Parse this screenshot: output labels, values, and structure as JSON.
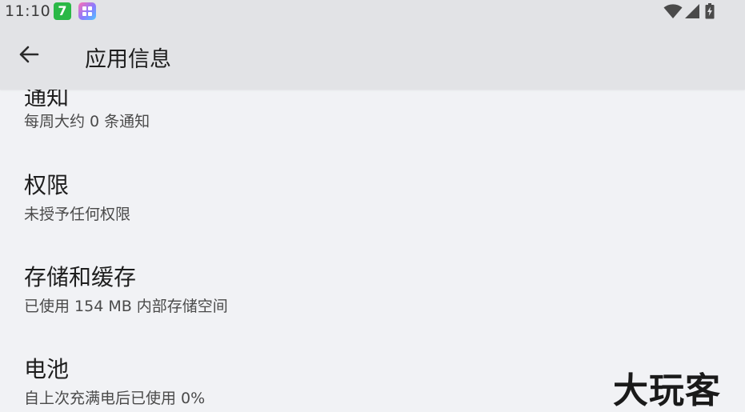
{
  "status_bar": {
    "time": "11:10",
    "notification_icon_a": "7",
    "icons": [
      "wifi-icon",
      "cell-signal-icon",
      "battery-charging-icon"
    ]
  },
  "app_bar": {
    "title": "应用信息",
    "back_icon": "arrow-left-icon"
  },
  "settings_items": [
    {
      "title": "通知",
      "subtitle": "每周大约 0 条通知"
    },
    {
      "title": "权限",
      "subtitle": "未授予任何权限"
    },
    {
      "title": "存储和缓存",
      "subtitle": "已使用 154 MB 内部存储空间"
    },
    {
      "title": "电池",
      "subtitle": "自上次充满电后已使用 0%"
    }
  ],
  "watermark": "大玩客",
  "colors": {
    "background": "#f1f2f5",
    "bars": "#e2e3e6",
    "notification_green": "#2ab846"
  }
}
